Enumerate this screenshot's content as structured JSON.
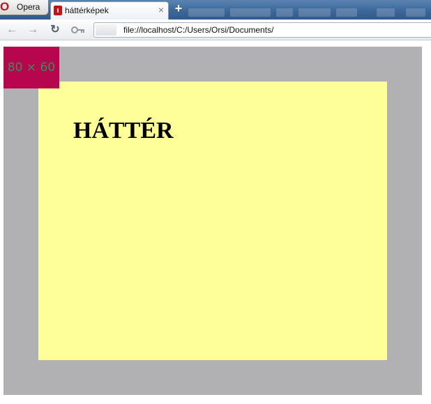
{
  "browser": {
    "menu_label": "Opera",
    "tab": {
      "title": "háttérképek",
      "close_glyph": "×"
    },
    "new_tab_glyph": "+",
    "address": "file://localhost/C:/Users/Orsi/Documents/",
    "icons": [
      "opera-logo-icon",
      "back-arrow-icon",
      "forward-arrow-icon",
      "reload-icon",
      "key-icon"
    ]
  },
  "page": {
    "marker_label": "80 × 60",
    "heading": "HÁTTÉR",
    "colors": {
      "outer_box": "#b1b1b4",
      "marker": "#b8064e",
      "inner_box": "#ffff99",
      "corner": "#ff0000"
    }
  }
}
